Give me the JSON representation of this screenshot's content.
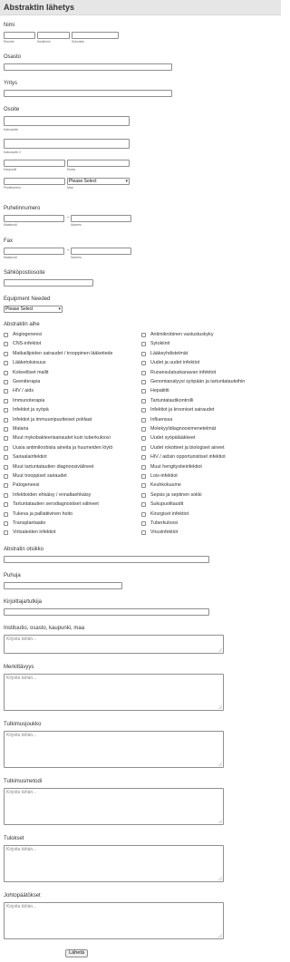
{
  "header": {
    "title": "Abstraktin lähetys"
  },
  "name": {
    "label": "Nimi",
    "first_sub": "Etunimi",
    "middle_sub": "Keskinimi",
    "last_sub": "Sukunimi"
  },
  "department": {
    "label": "Osasto"
  },
  "company": {
    "label": "Yritys"
  },
  "address": {
    "label": "Osoite",
    "street1_sub": "Katuosoite",
    "street2_sub": "Katuosoite 2",
    "city_sub": "Kaupunki",
    "region_sub": "Kunta",
    "postal_sub": "Postinumero",
    "country_sub": "Maa",
    "country_select": "Please Select"
  },
  "phone": {
    "label": "Puhelinnumero",
    "area_sub": "Maakoodi",
    "number_sub": "Numero",
    "dash": "-"
  },
  "fax": {
    "label": "Fax",
    "area_sub": "Maakoodi",
    "number_sub": "Numero",
    "dash": "-"
  },
  "email": {
    "label": "Sähköpostiosoite"
  },
  "equipment": {
    "label": "Equipment Needed",
    "select": "Please Select"
  },
  "topic": {
    "label": "Abstraktin aihe",
    "left": [
      "Angiogeneesi",
      "CNS-infektiot",
      "Matkailijoiden sairaudet / trooppinen lääketiede",
      "Lääketoksisuus",
      "Kokeelliset mallit",
      "Geeniterapia",
      "HIV / aids",
      "Immunoterapia",
      "Infektiot ja syöpä",
      "Infektiot ja immuunipuutteiset potilaat",
      "Malaria",
      "Muut mykobakteerisairaudet kuin tuberkuloosi",
      "Uusia antimikrobisia aineita ja huumeiden löytö",
      "Sairaalainfektiot",
      "Muut tartuntatautien diagnoosivälineet",
      "Muut trooppiset sairaudet",
      "Patogeneesi",
      "Infektioiden ehkäisy / ennaltaehkäisy",
      "Tartuntatautien serodiagnostiset välineet",
      "Tukeva ja palliatiivinen hoito",
      "Transplantaatio",
      "Virtsateiden infektiot"
    ],
    "right": [
      "Antimikrobinen vastustuskyky",
      "Sytokiinit",
      "Lääkeyhdistelmät",
      "Uudet ja uudet infektiot",
      "Ruoansulatuskanavan infektiot",
      "Genomianalyysi syöpään ja tartuntatauteihin",
      "Hepatiitti",
      "Tartuntatautikontrolli",
      "Infektiot ja krooniset sairaudet",
      "Influenssa",
      "Molekyylidiagnoosimenetelmät",
      "Uudet syöpälääkkeet",
      "Uudet rokotteet ja biologiset aineet",
      "HIV / aidsin opportunistiset infektiot",
      "Muut hengitystieinfektiot",
      "Lois-infektiot",
      "Keuhkokuume",
      "Sepsis ja septinen sokki",
      "Sukupuolitaudit",
      "Kirurgiset infektiot",
      "Tuberkuloosi",
      "Virusinfektiot"
    ]
  },
  "abstract_title": {
    "label": "Abstratin otsikko"
  },
  "speaker": {
    "label": "Puhuja"
  },
  "authors": {
    "label": "Kirjoittaja/tutkija"
  },
  "textareas": {
    "placeholder": "Kirjoita tähän...",
    "institution_label": "Instituutio, osasto, kaupunki, maa",
    "significance_label": "Merkittävyys",
    "group_label": "Tutkimusjoukko",
    "method_label": "Tutkimusmetodi",
    "results_label": "Tulokset",
    "conclusions_label": "Johtopäätökset"
  },
  "submit": {
    "label": "Lähetä"
  }
}
